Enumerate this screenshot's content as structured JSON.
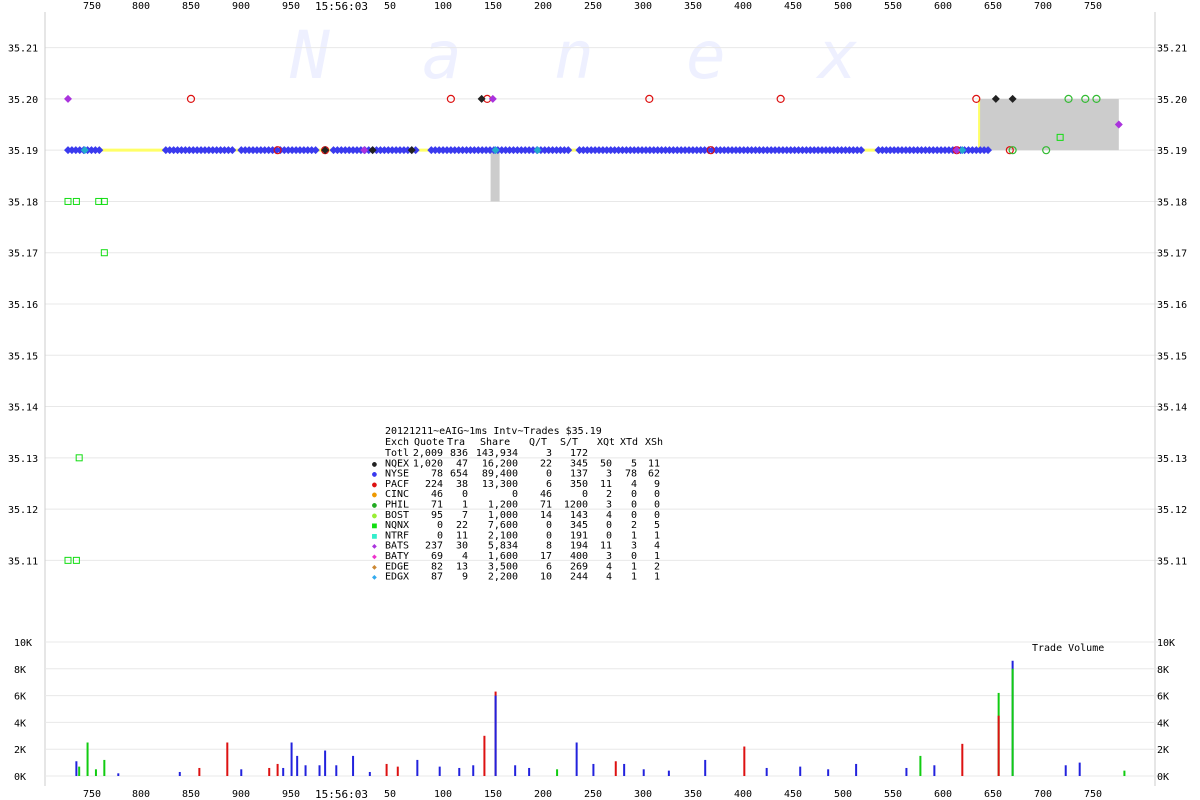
{
  "chart_data": [
    {
      "type": "scatter",
      "id": "price",
      "watermark": "Nanex",
      "ylim": [
        35.105,
        35.215
      ],
      "y_ticks": [
        "35.21",
        "35.20",
        "35.19",
        "35.18",
        "35.17",
        "35.16",
        "35.15",
        "35.14",
        "35.13",
        "35.12",
        "35.11"
      ],
      "x_ticks_left": [
        "750",
        "800",
        "850",
        "900",
        "950"
      ],
      "center_time": "15:56:03",
      "x_ticks_right": [
        "50",
        "100",
        "150",
        "200",
        "250",
        "300",
        "350",
        "400",
        "450",
        "500",
        "550",
        "600",
        "650",
        "700",
        "750"
      ],
      "series": [
        {
          "name": "NYSE",
          "color": "#3a3aee",
          "shape": "diamond",
          "dense_runs": [
            [
              0,
              12
            ],
            [
              35,
              60
            ],
            [
              62,
              90
            ],
            [
              95,
              125
            ],
            [
              130,
              180
            ],
            [
              183,
              285
            ],
            [
              290,
              330
            ]
          ],
          "y": 35.19
        },
        {
          "name": "PACF",
          "color": "#dd1111",
          "shape": "circle",
          "points": [
            [
              75,
              35.19
            ],
            [
              92,
              35.19
            ],
            [
              230,
              35.19
            ],
            [
              318,
              35.19
            ],
            [
              44,
              35.2
            ],
            [
              137,
              35.2
            ],
            [
              150,
              35.2
            ],
            [
              208,
              35.2
            ],
            [
              255,
              35.2
            ],
            [
              325,
              35.2
            ],
            [
              337,
              35.19
            ]
          ]
        },
        {
          "name": "NQEX",
          "color": "#222222",
          "shape": "diamond",
          "points": [
            [
              92,
              35.19
            ],
            [
              109,
              35.19
            ],
            [
              123,
              35.19
            ],
            [
              148,
              35.2
            ],
            [
              332,
              35.2
            ],
            [
              338,
              35.2
            ]
          ]
        },
        {
          "name": "BATS",
          "color": "#aa33dd",
          "shape": "diamond",
          "points": [
            [
              0,
              35.2
            ],
            [
              152,
              35.2
            ],
            [
              376,
              35.195
            ],
            [
              106,
              35.19
            ],
            [
              318,
              35.19
            ]
          ]
        },
        {
          "name": "NQNX",
          "color": "#11dd11",
          "shape": "square",
          "points": [
            [
              0,
              35.18
            ],
            [
              3,
              35.18
            ],
            [
              11,
              35.18
            ],
            [
              13,
              35.18
            ],
            [
              13,
              35.17
            ],
            [
              4,
              35.13
            ],
            [
              0,
              35.11
            ],
            [
              3,
              35.11
            ],
            [
              355,
              35.1925
            ]
          ]
        },
        {
          "name": "PHIL",
          "color": "#33bb33",
          "shape": "circle",
          "points": [
            [
              338,
              35.19
            ],
            [
              350,
              35.19
            ],
            [
              368,
              35.2
            ],
            [
              358,
              35.2
            ],
            [
              364,
              35.2
            ]
          ]
        },
        {
          "name": "EDGX",
          "color": "#22aacc",
          "shape": "diamond",
          "points": [
            [
              153,
              35.19
            ],
            [
              168,
              35.19
            ],
            [
              320,
              35.19
            ],
            [
              6,
              35.19
            ]
          ]
        }
      ],
      "nbbo_band": {
        "bid": 35.19,
        "ask": 35.2,
        "color": "#cccccc",
        "edge_color": "#ffff66"
      },
      "legend": "none"
    },
    {
      "type": "bar",
      "id": "volume",
      "title": "Trade Volume",
      "ylim": [
        0,
        10000
      ],
      "y_ticks": [
        "10K",
        "8K",
        "6K",
        "4K",
        "2K",
        "0K"
      ],
      "series_colors": {
        "NYSE": "#2222dd",
        "PACF": "#dd1111",
        "NQNX": "#11cc11",
        "BATS": "#aa33dd"
      },
      "bars": [
        {
          "s": "NYSE",
          "x": 3,
          "v": 1100
        },
        {
          "s": "NQNX",
          "x": 4,
          "v": 700
        },
        {
          "s": "NQNX",
          "x": 7,
          "v": 2500
        },
        {
          "s": "NQNX",
          "x": 10,
          "v": 500
        },
        {
          "s": "NQNX",
          "x": 13,
          "v": 1200
        },
        {
          "s": "NYSE",
          "x": 18,
          "v": 200
        },
        {
          "s": "NYSE",
          "x": 40,
          "v": 300
        },
        {
          "s": "PACF",
          "x": 47,
          "v": 600
        },
        {
          "s": "PACF",
          "x": 57,
          "v": 2500
        },
        {
          "s": "NYSE",
          "x": 62,
          "v": 500
        },
        {
          "s": "PACF",
          "x": 72,
          "v": 600
        },
        {
          "s": "PACF",
          "x": 75,
          "v": 900
        },
        {
          "s": "NYSE",
          "x": 77,
          "v": 600
        },
        {
          "s": "NYSE",
          "x": 80,
          "v": 2500
        },
        {
          "s": "NYSE",
          "x": 82,
          "v": 1500
        },
        {
          "s": "NYSE",
          "x": 85,
          "v": 800
        },
        {
          "s": "NYSE",
          "x": 90,
          "v": 800
        },
        {
          "s": "NYSE",
          "x": 92,
          "v": 1900
        },
        {
          "s": "NYSE",
          "x": 96,
          "v": 800
        },
        {
          "s": "NYSE",
          "x": 102,
          "v": 1500
        },
        {
          "s": "NYSE",
          "x": 108,
          "v": 300
        },
        {
          "s": "PACF",
          "x": 114,
          "v": 900
        },
        {
          "s": "PACF",
          "x": 118,
          "v": 700
        },
        {
          "s": "NYSE",
          "x": 125,
          "v": 1200
        },
        {
          "s": "NYSE",
          "x": 133,
          "v": 700
        },
        {
          "s": "NYSE",
          "x": 140,
          "v": 600
        },
        {
          "s": "NYSE",
          "x": 145,
          "v": 800
        },
        {
          "s": "PACF",
          "x": 149,
          "v": 3000
        },
        {
          "s": "PACF",
          "x": 153,
          "v": 6300
        },
        {
          "s": "NYSE",
          "x": 153,
          "v": 6000
        },
        {
          "s": "NYSE",
          "x": 160,
          "v": 800
        },
        {
          "s": "NYSE",
          "x": 165,
          "v": 600
        },
        {
          "s": "NQNX",
          "x": 175,
          "v": 500
        },
        {
          "s": "NYSE",
          "x": 182,
          "v": 2500
        },
        {
          "s": "NYSE",
          "x": 188,
          "v": 900
        },
        {
          "s": "PACF",
          "x": 196,
          "v": 1100
        },
        {
          "s": "NYSE",
          "x": 199,
          "v": 900
        },
        {
          "s": "NYSE",
          "x": 206,
          "v": 500
        },
        {
          "s": "NYSE",
          "x": 215,
          "v": 400
        },
        {
          "s": "NYSE",
          "x": 228,
          "v": 1200
        },
        {
          "s": "PACF",
          "x": 242,
          "v": 2200
        },
        {
          "s": "NYSE",
          "x": 250,
          "v": 600
        },
        {
          "s": "NYSE",
          "x": 262,
          "v": 700
        },
        {
          "s": "NYSE",
          "x": 272,
          "v": 500
        },
        {
          "s": "NYSE",
          "x": 282,
          "v": 900
        },
        {
          "s": "NYSE",
          "x": 300,
          "v": 600
        },
        {
          "s": "NQNX",
          "x": 305,
          "v": 1500
        },
        {
          "s": "NYSE",
          "x": 310,
          "v": 800
        },
        {
          "s": "PACF",
          "x": 320,
          "v": 2400
        },
        {
          "s": "NQNX",
          "x": 333,
          "v": 6200
        },
        {
          "s": "PACF",
          "x": 333,
          "v": 4500
        },
        {
          "s": "NYSE",
          "x": 338,
          "v": 8600
        },
        {
          "s": "NQNX",
          "x": 338,
          "v": 8000
        },
        {
          "s": "NYSE",
          "x": 357,
          "v": 800
        },
        {
          "s": "NYSE",
          "x": 362,
          "v": 1000
        },
        {
          "s": "NQNX",
          "x": 378,
          "v": 400
        }
      ]
    }
  ],
  "table": {
    "title": "20121211~eAIG~1ms Intv~Trades $35.19",
    "headers": [
      "Exch",
      "Quote",
      "Tra",
      "Share",
      "Q/T",
      "S/T",
      "XQt",
      "XTd",
      "XSh"
    ],
    "rows": [
      {
        "marker_color": "",
        "marker": "",
        "cells": [
          "Totl",
          "2,009",
          "836",
          "143,934",
          "3",
          "172",
          "",
          "",
          ""
        ]
      },
      {
        "marker_color": "#222222",
        "marker": "●",
        "cells": [
          "NQEX",
          "1,020",
          "47",
          "16,200",
          "22",
          "345",
          "50",
          "5",
          "11"
        ]
      },
      {
        "marker_color": "#3a3aee",
        "marker": "●",
        "cells": [
          "NYSE",
          "78",
          "654",
          "89,400",
          "0",
          "137",
          "3",
          "78",
          "62"
        ]
      },
      {
        "marker_color": "#dd1111",
        "marker": "●",
        "cells": [
          "PACF",
          "224",
          "38",
          "13,300",
          "6",
          "350",
          "11",
          "4",
          "9"
        ]
      },
      {
        "marker_color": "#ee9900",
        "marker": "●",
        "cells": [
          "CINC",
          "46",
          "0",
          "0",
          "46",
          "0",
          "2",
          "0",
          "0"
        ]
      },
      {
        "marker_color": "#22aa22",
        "marker": "●",
        "cells": [
          "PHIL",
          "71",
          "1",
          "1,200",
          "71",
          "1200",
          "3",
          "0",
          "0"
        ]
      },
      {
        "marker_color": "#99ee33",
        "marker": "●",
        "cells": [
          "BOST",
          "95",
          "7",
          "1,000",
          "14",
          "143",
          "4",
          "0",
          "0"
        ]
      },
      {
        "marker_color": "#11dd11",
        "marker": "■",
        "cells": [
          "NQNX",
          "0",
          "22",
          "7,600",
          "0",
          "345",
          "0",
          "2",
          "5"
        ]
      },
      {
        "marker_color": "#33eecc",
        "marker": "■",
        "cells": [
          "NTRF",
          "0",
          "11",
          "2,100",
          "0",
          "191",
          "0",
          "1",
          "1"
        ]
      },
      {
        "marker_color": "#aa33dd",
        "marker": "◆",
        "cells": [
          "BATS",
          "237",
          "30",
          "5,834",
          "8",
          "194",
          "11",
          "3",
          "4"
        ]
      },
      {
        "marker_color": "#ee33cc",
        "marker": "◆",
        "cells": [
          "BATY",
          "69",
          "4",
          "1,600",
          "17",
          "400",
          "3",
          "0",
          "1"
        ]
      },
      {
        "marker_color": "#cc8833",
        "marker": "◆",
        "cells": [
          "EDGE",
          "82",
          "13",
          "3,500",
          "6",
          "269",
          "4",
          "1",
          "2"
        ]
      },
      {
        "marker_color": "#33aaee",
        "marker": "◆",
        "cells": [
          "EDGX",
          "87",
          "9",
          "2,200",
          "10",
          "244",
          "4",
          "1",
          "1"
        ]
      }
    ]
  }
}
